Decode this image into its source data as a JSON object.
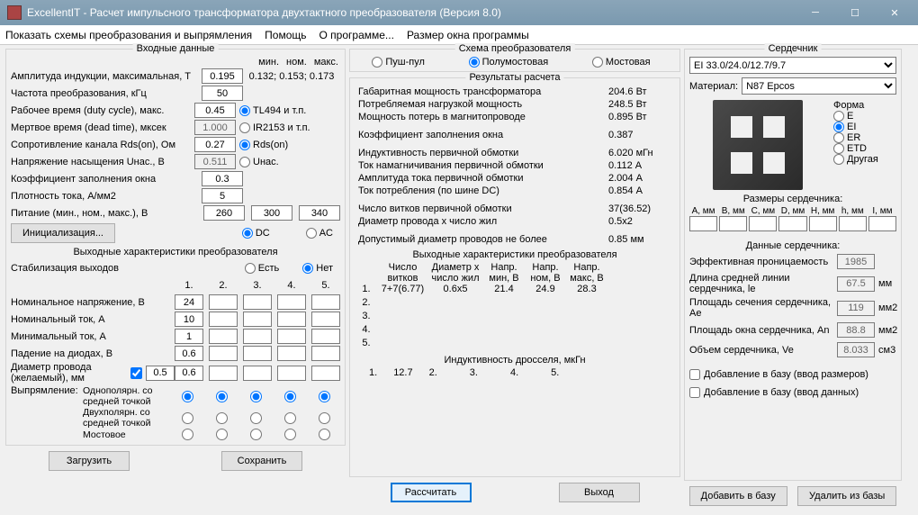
{
  "window": {
    "title": "ExcellentIT - Расчет импульсного трансформатора двухтактного преобразователя (Версия 8.0)"
  },
  "menu": {
    "m1": "Показать схемы преобразования и выпрямления",
    "m2": "Помощь",
    "m3": "О программе...",
    "m4": "Размер окна программы"
  },
  "input": {
    "title": "Входные данные",
    "minnom": {
      "min": "мин.",
      "nom": "ном.",
      "max": "макс."
    },
    "amp": {
      "lbl": "Амплитуда индукции, максимальная, Т",
      "val": "0.195",
      "min": "0.132;",
      "nom": "0.153;",
      "max": "0.173"
    },
    "freq": {
      "lbl": "Частота преобразования, кГц",
      "val": "50"
    },
    "duty": {
      "lbl": "Рабочее время (duty cycle), макс.",
      "val": "0.45",
      "r1": "TL494 и т.п."
    },
    "dead": {
      "lbl": "Мертвое время (dead time), мксек",
      "val": "1.000",
      "r2": "IR2153 и т.п."
    },
    "rds": {
      "lbl": "Сопротивление канала Rds(on), Ом",
      "val": "0.27",
      "r3": "Rds(on)"
    },
    "usat": {
      "lbl": "Напряжение насыщения Uнас., В",
      "val": "0.511",
      "r4": "Uнас."
    },
    "fill": {
      "lbl": "Коэффициент заполнения окна",
      "val": "0.3"
    },
    "curd": {
      "lbl": "Плотность тока, А/мм2",
      "val": "5"
    },
    "pwr": {
      "lbl": "Питание (мин., ном., макс.), В",
      "v1": "260",
      "v2": "300",
      "v3": "340"
    },
    "dc": "DC",
    "ac": "AC",
    "init": "Инициализация...",
    "outchar": "Выходные характеристики преобразователя",
    "stab": {
      "lbl": "Стабилизация выходов",
      "yes": "Есть",
      "no": "Нет"
    },
    "cols": [
      "1.",
      "2.",
      "3.",
      "4.",
      "5."
    ],
    "nomv": {
      "lbl": "Номинальное напряжение, В",
      "v": [
        "24",
        "",
        "",
        "",
        ""
      ]
    },
    "nomc": {
      "lbl": "Номинальный ток, А",
      "v": [
        "10",
        "",
        "",
        "",
        ""
      ]
    },
    "minc": {
      "lbl": "Минимальный ток, А",
      "v": [
        "1",
        "",
        "",
        "",
        ""
      ]
    },
    "diod": {
      "lbl": "Падение на диодах, В",
      "v": [
        "0.6",
        "",
        "",
        "",
        ""
      ]
    },
    "wire": {
      "lbl": "Диаметр провода (желаемый), мм",
      "chk": true,
      "v": [
        "0.5",
        "0.6",
        "",
        "",
        "",
        ""
      ]
    },
    "rect": {
      "lbl": "Выпрямление:",
      "r1": "Однополярн. со средней точкой",
      "r2": "Двухполярн. со средней точкой",
      "r3": "Мостовое"
    },
    "load": "Загрузить",
    "save": "Сохранить"
  },
  "scheme": {
    "title": "Схема преобразователя",
    "r1": "Пуш-пул",
    "r2": "Полумостовая",
    "r3": "Мостовая"
  },
  "results": {
    "title": "Результаты расчета",
    "r1": {
      "lbl": "Габаритная мощность трансформатора",
      "val": "204.6 Вт"
    },
    "r2": {
      "lbl": "Потребляемая нагрузкой мощность",
      "val": "248.5 Вт"
    },
    "r3": {
      "lbl": "Мощность потерь в магнитопроводе",
      "val": "0.895 Вт"
    },
    "r4": {
      "lbl": "Коэффициент заполнения окна",
      "val": "0.387"
    },
    "r5": {
      "lbl": "Индуктивность первичной обмотки",
      "val": "6.020 мГн"
    },
    "r6": {
      "lbl": "Ток намагничивания первичной обмотки",
      "val": "0.112 А"
    },
    "r7": {
      "lbl": "Амплитуда тока первичной обмотки",
      "val": "2.004 А"
    },
    "r8": {
      "lbl": "Ток потребления (по шине DC)",
      "val": "0.854 А"
    },
    "r9": {
      "lbl": "Число витков первичной обмотки",
      "val": "37(36.52)"
    },
    "r10": {
      "lbl": "Диаметр провода х число жил",
      "val": "0.5х2"
    },
    "r11": {
      "lbl": "Допустимый диаметр проводов не более",
      "val": "0.85 мм"
    },
    "outtitle": "Выходные характеристики преобразователя",
    "hdr": {
      "c1": "Число витков",
      "c2": "Диаметр х число жил",
      "c3": "Напр. мин, В",
      "c4": "Напр. ном, В",
      "c5": "Напр. макс, В"
    },
    "row1": {
      "n": "1.",
      "v1": "7+7(6.77)",
      "v2": "0.6х5",
      "v3": "21.4",
      "v4": "24.9",
      "v5": "28.3"
    },
    "rows": [
      "2.",
      "3.",
      "4.",
      "5."
    ],
    "indtitle": "Индуктивность дросселя, мкГн",
    "ind": {
      "n": "1.",
      "v": "12.7",
      "rest": [
        "2.",
        "3.",
        "4.",
        "5."
      ]
    },
    "calc": "Рассчитать",
    "exit": "Выход"
  },
  "core": {
    "title": "Сердечник",
    "sel": "EI 33.0/24.0/12.7/9.7",
    "mat": {
      "lbl": "Материал:",
      "val": "N87 Epcos"
    },
    "shape": {
      "lbl": "Форма",
      "opts": [
        "E",
        "EI",
        "ER",
        "ETD",
        "Другая"
      ]
    },
    "sztitle": "Размеры сердечника:",
    "szh": [
      "A, мм",
      "B, мм",
      "C, мм",
      "D, мм",
      "H, мм",
      "h, мм",
      "I, мм"
    ],
    "datatitle": "Данные сердечника:",
    "d1": {
      "lbl": "Эффективная проницаемость",
      "val": "1985"
    },
    "d2": {
      "lbl": "Длина средней линии сердечника, le",
      "val": "67.5",
      "u": "мм"
    },
    "d3": {
      "lbl": "Площадь сечения сердечника, Ae",
      "val": "119",
      "u": "мм2"
    },
    "d4": {
      "lbl": "Площадь окна сердечника, An",
      "val": "88.8",
      "u": "мм2"
    },
    "d5": {
      "lbl": "Объем сердечника, Ve",
      "val": "8.033",
      "u": "см3"
    },
    "chk1": "Добавление в базу (ввод размеров)",
    "chk2": "Добавление в базу (ввод данных)",
    "add": "Добавить в базу",
    "del": "Удалить из базы"
  }
}
